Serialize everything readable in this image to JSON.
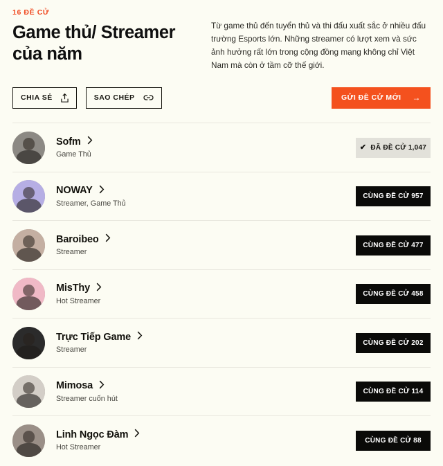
{
  "header": {
    "eyebrow": "16 ĐỀ CỬ",
    "title": "Game thủ/ Streamer của năm",
    "description": "Từ game thủ đến tuyển thủ và thi đấu xuất sắc ở nhiều đấu trường Esports lớn. Những streamer có lượt xem và sức ảnh hưởng rất lớn trong cộng đồng mạng không chỉ Việt Nam mà còn ở tầm cỡ thế giới."
  },
  "actions": {
    "share_label": "CHIA SẺ",
    "share_icon": "share-upload-icon",
    "copy_label": "SAO CHÉP",
    "copy_icon": "link-icon",
    "cta_label": "GỬI ĐỀ CỬ MỚI",
    "cta_arrow": "→",
    "cta_color": "#F4511E"
  },
  "colors": {
    "background": "#FCFCF3",
    "accent": "#F04A21",
    "vote_active_bg": "#0A0A08",
    "vote_done_bg": "#E2E1DA",
    "divider": "#E8E7DE"
  },
  "list": {
    "vote_label": "CÙNG ĐỀ CỬ",
    "voted_label": "ĐÃ ĐỀ CỬ",
    "check_glyph": "✔",
    "chevron_icon": "chevron-right-icon",
    "items": [
      {
        "name": "Sofm",
        "role": "Game Thủ",
        "votes": "1,047",
        "voted": true,
        "button_label": "ĐÃ ĐỀ CỬ 1,047",
        "avatar_bg": "#8C8984"
      },
      {
        "name": "NOWAY",
        "role": "Streamer, Game Thủ",
        "votes": "957",
        "voted": false,
        "button_label": "CÙNG ĐỀ CỬ 957",
        "avatar_bg": "#B6AEE4"
      },
      {
        "name": "Baroibeo",
        "role": "Streamer",
        "votes": "477",
        "voted": false,
        "button_label": "CÙNG ĐỀ CỬ 477",
        "avatar_bg": "#C4AFA2"
      },
      {
        "name": "MisThy",
        "role": "Hot Streamer",
        "votes": "458",
        "voted": false,
        "button_label": "CÙNG ĐỀ CỬ 458",
        "avatar_bg": "#F0B9C6"
      },
      {
        "name": "Trực Tiếp Game",
        "role": "Streamer",
        "votes": "202",
        "voted": false,
        "button_label": "CÙNG ĐỀ CỬ 202",
        "avatar_bg": "#2B2B2B"
      },
      {
        "name": "Mimosa",
        "role": "Streamer cuốn hút",
        "votes": "114",
        "voted": false,
        "button_label": "CÙNG ĐỀ CỬ 114",
        "avatar_bg": "#D3CEC7"
      },
      {
        "name": "Linh Ngọc Đàm",
        "role": "Hot Streamer",
        "votes": "88",
        "voted": false,
        "button_label": "CÙNG ĐỀ CỬ 88",
        "avatar_bg": "#9A8F87"
      }
    ]
  }
}
